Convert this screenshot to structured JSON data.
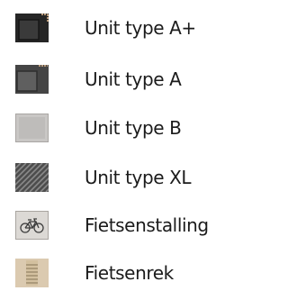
{
  "legend": {
    "items": [
      {
        "label": "Unit type A+",
        "icon": "unit-type-a-plus-swatch",
        "color": "#2c2c2c"
      },
      {
        "label": "Unit type A",
        "icon": "unit-type-a-swatch",
        "color": "#4a4a4a"
      },
      {
        "label": "Unit type B",
        "icon": "unit-type-b-swatch",
        "color": "#c9c7c5"
      },
      {
        "label": "Unit type XL",
        "icon": "unit-type-xl-swatch",
        "color": "#5a5a5a"
      },
      {
        "label": "Fietsenstalling",
        "icon": "bicycle-icon",
        "color": "#d8d4cf"
      },
      {
        "label": "Fietsenrek",
        "icon": "bike-rack-icon",
        "color": "#d6c4a6"
      }
    ]
  }
}
